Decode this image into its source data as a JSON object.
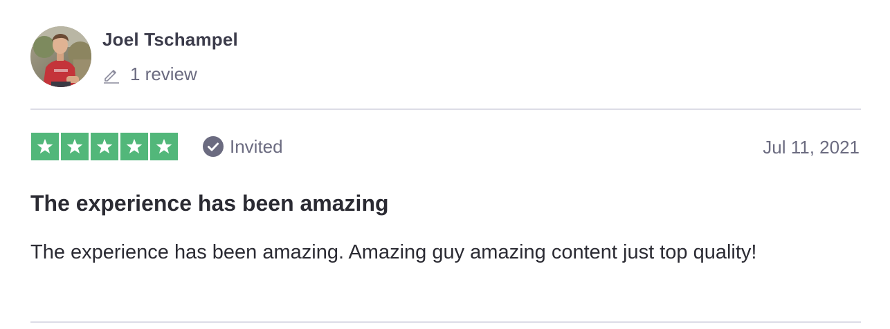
{
  "consumer": {
    "name": "Joel Tschampel",
    "review_count": "1 review",
    "avatar": "profile-photo"
  },
  "review": {
    "rating": 5,
    "max_rating": 5,
    "badge_label": "Invited",
    "date": "Jul 11, 2021",
    "title": "The experience has been amazing",
    "body": "The experience has been amazing. Amazing guy amazing content just top quality!"
  },
  "icons": {
    "review_count_icon": "pencil-icon",
    "badge_icon": "check-circle-icon",
    "star_icon": "star-icon"
  },
  "colors": {
    "star_green": "#52b77a",
    "muted_text": "#6b6b80",
    "divider": "#dcdce6",
    "heading_text": "#2b2b33"
  }
}
